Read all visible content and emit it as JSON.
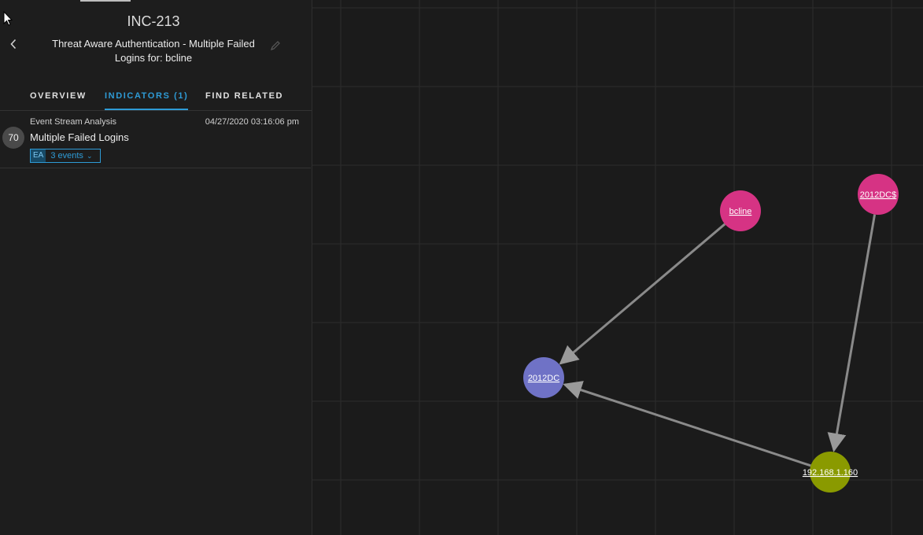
{
  "incident": {
    "id": "INC-213",
    "title": "Threat Aware Authentication - Multiple Failed Logins for: bcline"
  },
  "tabs": [
    {
      "label": "OVERVIEW",
      "active": false
    },
    {
      "label": "INDICATORS (1)",
      "active": true
    },
    {
      "label": "FIND RELATED",
      "active": false
    }
  ],
  "indicator": {
    "risk_score": "70",
    "source": "Event Stream Analysis",
    "timestamp": "04/27/2020 03:16:06 pm",
    "name": "Multiple Failed Logins",
    "badge": "EA",
    "events_label": "3 events"
  },
  "icons": {
    "back": "chevron-left-icon",
    "edit": "pencil-icon",
    "events_toggle": "chevron-down-icon"
  },
  "colors": {
    "accent": "#2e9bd6",
    "user_node": "#d63384",
    "host_node": "#6f72c6",
    "ip_node": "#8a9a00",
    "edge": "#8a8a8a"
  },
  "graph": {
    "nodes": [
      {
        "id": "bcline",
        "label": "bcline",
        "type": "user"
      },
      {
        "id": "2012DC$",
        "label": "2012DC$",
        "type": "user"
      },
      {
        "id": "2012DC",
        "label": "2012DC",
        "type": "host"
      },
      {
        "id": "192.168.1.160",
        "label": "192.168.1.160",
        "type": "ip"
      }
    ],
    "edges": [
      {
        "from": "bcline",
        "to": "2012DC"
      },
      {
        "from": "2012DC$",
        "to": "192.168.1.160"
      },
      {
        "from": "192.168.1.160",
        "to": "2012DC"
      }
    ]
  }
}
